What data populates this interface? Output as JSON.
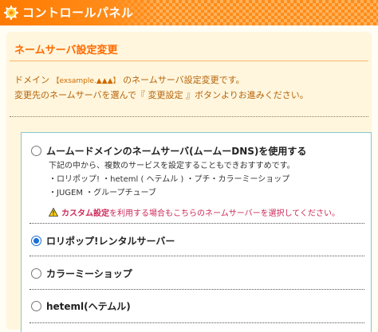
{
  "header": {
    "title": "コントロールパネル",
    "icon": "gear-icon"
  },
  "section": {
    "title": "ネームサーバ設定変更"
  },
  "description": {
    "line1_prefix": "ドメイン",
    "domain": "【exsample.▲▲▲】",
    "line1_suffix": "のネームサーバ設定変更です。",
    "line2": "変更先のネームサーバを選んで『 変更設定 』ボタンよりお進みください。"
  },
  "options": [
    {
      "label": "ムームードメインのネームサーバ(ムームーDNS)を使用する",
      "selected": false
    },
    {
      "label": "ロリポップ!レンタルサーバー",
      "selected": true
    },
    {
      "label": "カラーミーショップ",
      "selected": false
    },
    {
      "label": "heteml(ヘテムル)",
      "selected": false
    }
  ],
  "option0_details": {
    "line1": "下記の中から、複数のサービスを設定することもできおすすめです。",
    "line2": "・ロリポップ! ・heteml ( ヘテムル ) ・プチ・カラーミーショップ",
    "line3": "・JUGEM ・グループチューブ",
    "warning_em": "カスタム設定",
    "warning_rest": "を利用する場合もこちらのネームサーバーを選択してください。"
  },
  "colors": {
    "accent": "#ff6a00",
    "box_border": "#86c6d2",
    "warning": "#cc2a5a",
    "radio_selected": "#1a6fd8"
  }
}
